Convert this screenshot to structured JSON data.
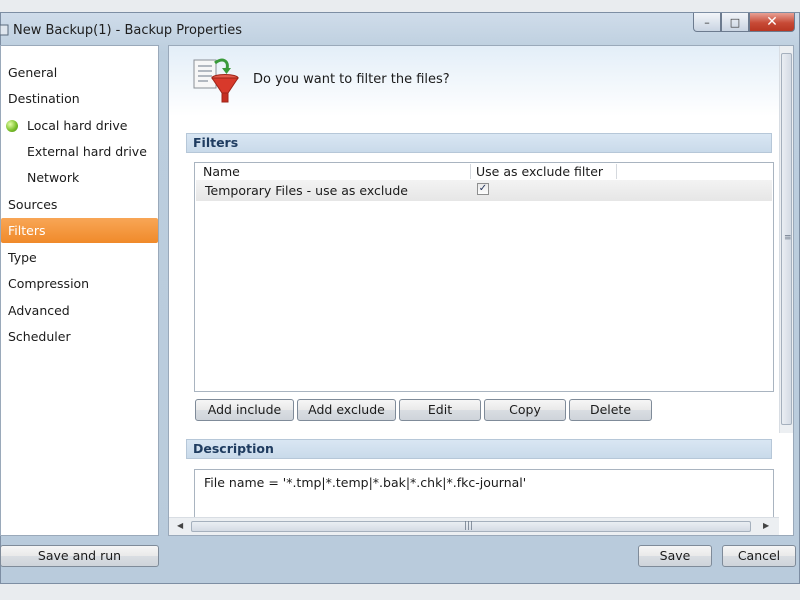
{
  "window": {
    "title": "New Backup(1) - Backup Properties",
    "controls": {
      "minimize": "–",
      "maximize": "□",
      "close": "✕"
    }
  },
  "sidebar": {
    "items": [
      {
        "label": "General"
      },
      {
        "label": "Destination"
      },
      {
        "label": "Local hard drive",
        "status_icon": "green-dot-icon"
      },
      {
        "label": "External hard drive"
      },
      {
        "label": "Network"
      },
      {
        "label": "Sources"
      },
      {
        "label": "Filters",
        "selected": true
      },
      {
        "label": "Type"
      },
      {
        "label": "Compression"
      },
      {
        "label": "Advanced"
      },
      {
        "label": "Scheduler"
      }
    ]
  },
  "page": {
    "icon": "filter-funnel-icon",
    "question": "Do you want to filter the files?"
  },
  "filters": {
    "header": "Filters",
    "columns": {
      "name": "Name",
      "exclude": "Use as exclude filter"
    },
    "rows": [
      {
        "name": "Temporary Files - use as exclude",
        "checked": true,
        "check_glyph": "✓"
      }
    ],
    "buttons": {
      "add_include": "Add include",
      "add_exclude": "Add exclude",
      "edit": "Edit",
      "copy": "Copy",
      "delete": "Delete"
    }
  },
  "description": {
    "header": "Description",
    "text": "File name = '*.tmp|*.temp|*.bak|*.chk|*.fkc-journal'"
  },
  "footer": {
    "save_and_run": "Save and run",
    "save": "Save",
    "cancel": "Cancel"
  },
  "colors": {
    "selected_nav": "#f08a2a",
    "section_header_text": "#1f3c60",
    "close_button": "#c74a36"
  }
}
